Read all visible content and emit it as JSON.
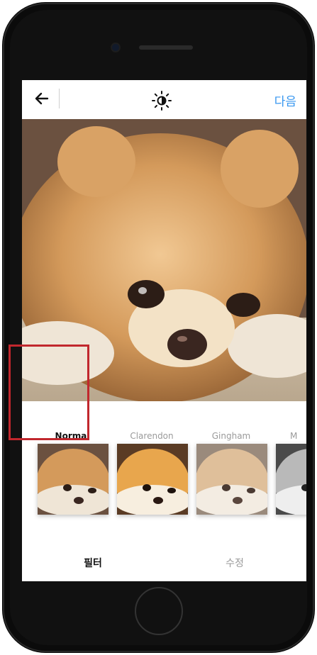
{
  "header": {
    "next_label": "다음"
  },
  "filters": [
    {
      "label": "Normal",
      "active": true
    },
    {
      "label": "Clarendon",
      "active": false
    },
    {
      "label": "Gingham",
      "active": false
    },
    {
      "label": "M",
      "active": false
    }
  ],
  "tabs": [
    {
      "label": "필터",
      "active": true
    },
    {
      "label": "수정",
      "active": false
    }
  ],
  "colors": {
    "accent": "#3897f0",
    "highlight": "#c1272d"
  },
  "icons": [
    "back-arrow-icon",
    "brightness-icon"
  ]
}
